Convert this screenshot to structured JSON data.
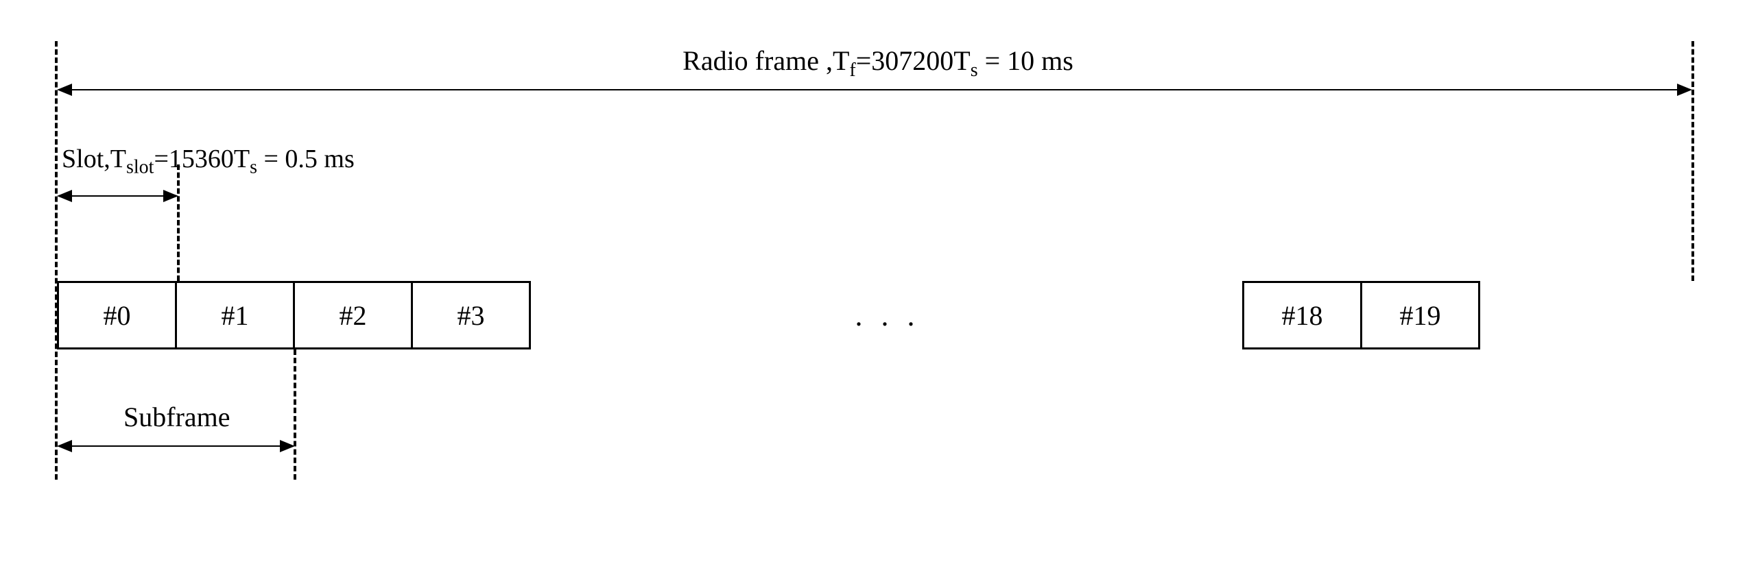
{
  "radio_frame": {
    "prefix": "Radio frame ,T",
    "sub1": "f",
    "mid1": "=307200T",
    "sub2": "s",
    "tail": " = 10 ms"
  },
  "slot_label": {
    "prefix": "Slot,T",
    "sub1": "slot",
    "mid1": "=15360T",
    "sub2": "s",
    "tail": " = 0.5 ms"
  },
  "subframe_label": "Subframe",
  "slots": {
    "s0": "#0",
    "s1": "#1",
    "s2": "#2",
    "s3": "#3",
    "s18": "#18",
    "s19": "#19"
  },
  "ellipsis": ". . ."
}
